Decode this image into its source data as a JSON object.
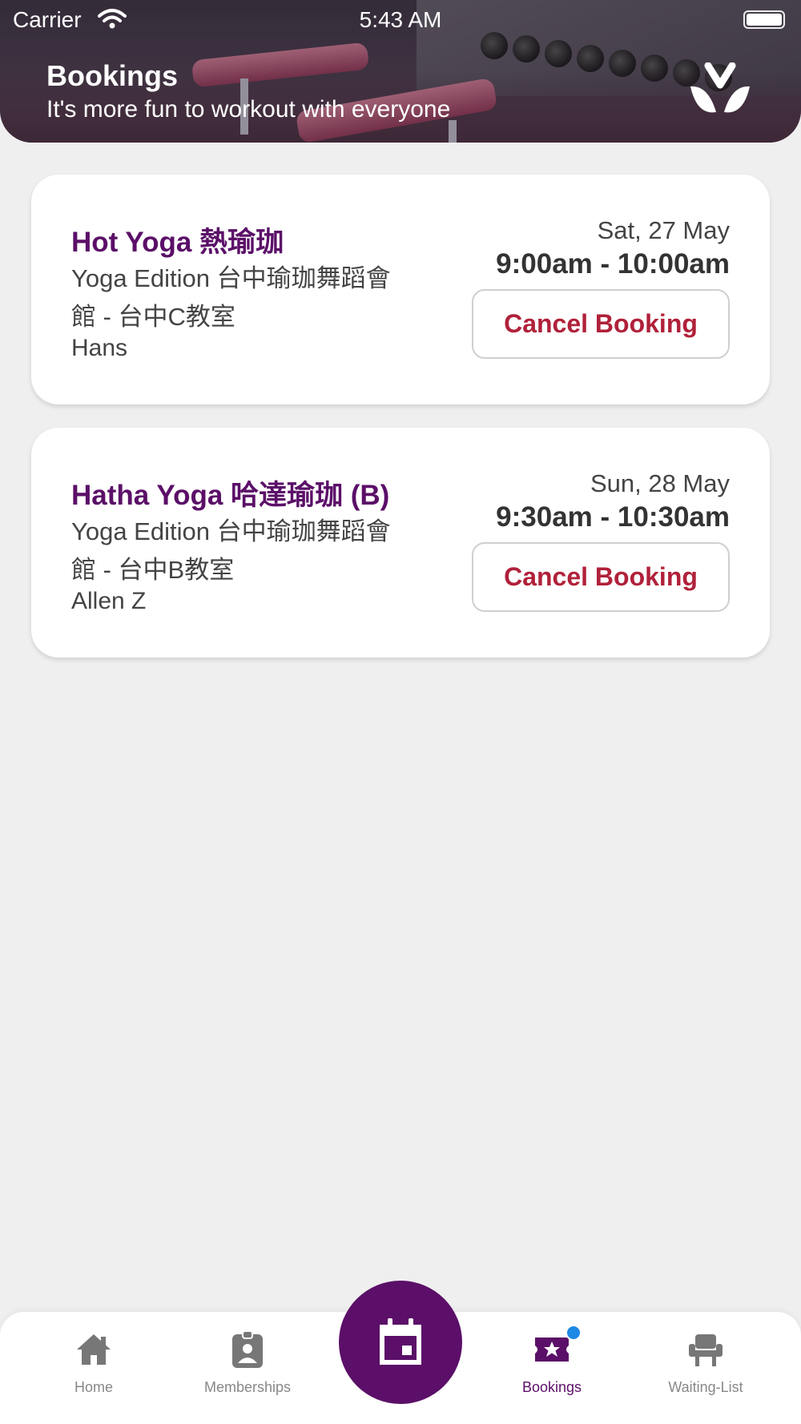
{
  "status_bar": {
    "carrier": "Carrier",
    "time": "5:43 AM"
  },
  "header": {
    "title": "Bookings",
    "subtitle": "It's more fun to workout with everyone"
  },
  "bookings": [
    {
      "class_name": "Hot Yoga 熱瑜珈",
      "studio": "Yoga Edition 台中瑜珈舞蹈會館 - 台中C教室",
      "instructor": "Hans",
      "date": "Sat, 27 May",
      "time": "9:00am - 10:00am",
      "action_label": "Cancel Booking"
    },
    {
      "class_name": "Hatha Yoga 哈達瑜珈 (B)",
      "studio": "Yoga Edition 台中瑜珈舞蹈會館 - 台中B教室",
      "instructor": "Allen Z",
      "date": "Sun, 28 May",
      "time": "9:30am - 10:30am",
      "action_label": "Cancel Booking"
    }
  ],
  "tabbar": {
    "items": [
      {
        "label": "Home",
        "icon": "home-icon"
      },
      {
        "label": "Memberships",
        "icon": "badge-icon"
      },
      {
        "label": "Bookings",
        "icon": "star-ticket-icon",
        "active": true
      },
      {
        "label": "Waiting-List",
        "icon": "chair-icon"
      }
    ],
    "center_icon": "calendar-icon"
  },
  "colors": {
    "brand_purple": "#5b0f68",
    "cancel_red": "#b0213a",
    "badge_blue": "#1e88e5",
    "background": "#efefef"
  }
}
